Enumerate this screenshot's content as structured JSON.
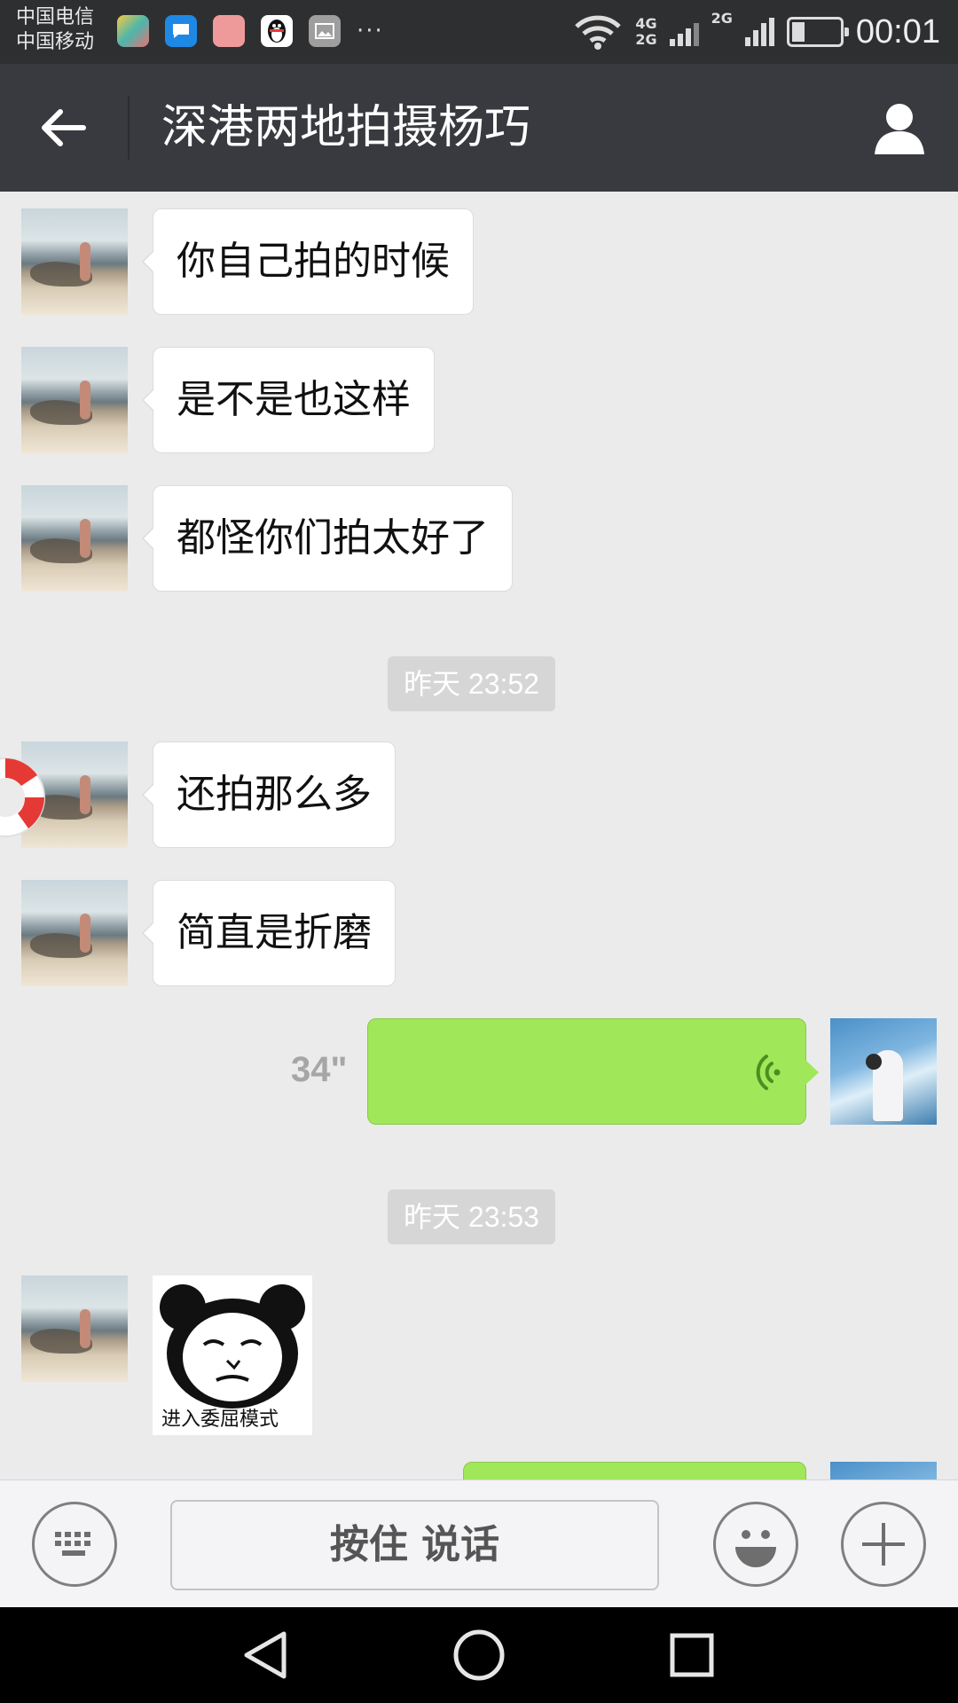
{
  "status_bar": {
    "carrier_1": "中国电信",
    "carrier_2": "中国移动",
    "notification_more": "···",
    "sim1_network": "4G",
    "sim1_network_2": "2G",
    "sim2_network": "2G",
    "battery_level": 0.2,
    "time": "00:01"
  },
  "header": {
    "title": "深港两地拍摄杨巧"
  },
  "messages": [
    {
      "type": "text",
      "side": "left",
      "text": "你自己拍的时候"
    },
    {
      "type": "text",
      "side": "left",
      "text": "是不是也这样"
    },
    {
      "type": "text",
      "side": "left",
      "text": "都怪你们拍太好了"
    },
    {
      "type": "timestamp",
      "text": "昨天 23:52"
    },
    {
      "type": "text",
      "side": "left",
      "text": "还拍那么多"
    },
    {
      "type": "text",
      "side": "left",
      "text": "简直是折磨"
    },
    {
      "type": "voice",
      "side": "right",
      "duration": "34\""
    },
    {
      "type": "timestamp",
      "text": "昨天 23:53"
    },
    {
      "type": "sticker",
      "side": "left",
      "caption": "进入委屈模式"
    },
    {
      "type": "voice",
      "side": "right",
      "duration": ""
    }
  ],
  "input_bar": {
    "hold_to_talk_label": "按住 说话"
  },
  "colors": {
    "header_bg": "#393a3f",
    "chat_bg": "#ebebeb",
    "voice_bubble": "#a0e75a",
    "timestamp_bg": "#d6d6d6"
  },
  "icons": {
    "back": "arrow-left-icon",
    "profile": "person-icon",
    "keyboard": "keyboard-icon",
    "emoji": "smiley-icon",
    "plus": "plus-icon",
    "nav_back": "triangle-back-icon",
    "nav_home": "circle-home-icon",
    "nav_recent": "square-recent-icon"
  }
}
